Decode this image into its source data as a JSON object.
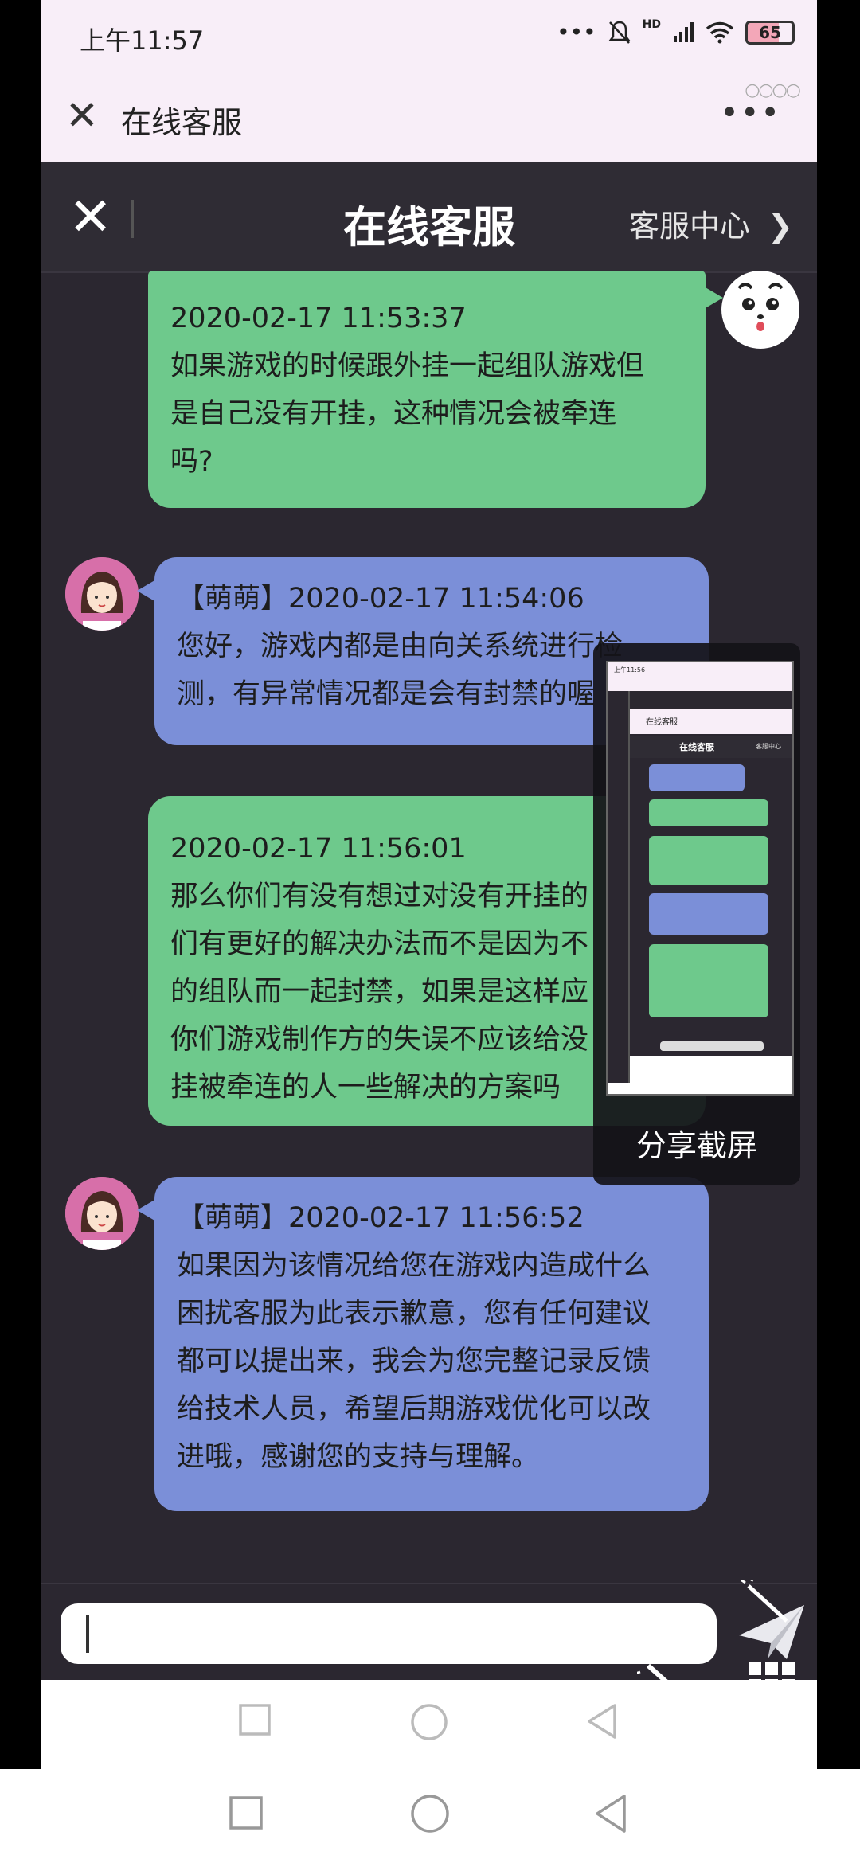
{
  "status_bar": {
    "time": "上午11:57",
    "icons": [
      "more-dots-icon",
      "mute-bell-icon",
      "signal-icon",
      "wifi-icon"
    ],
    "network_label": "HD",
    "battery": "65"
  },
  "app_bar": {
    "title": "在线客服",
    "more": "•••"
  },
  "web_header": {
    "title": "在线客服",
    "center_link": "客服中心"
  },
  "messages": [
    {
      "sender": "user",
      "lines": [
        "2020-02-17 11:53:37",
        "如果游戏的时候跟外挂一起组队游戏但",
        "是自己没有开挂，这种情况会被牵连",
        "吗?"
      ]
    },
    {
      "sender": "agent",
      "lines": [
        "【萌萌】2020-02-17 11:54:06",
        "您好，游戏内都是由向关系统进行检",
        "测，有异常情况都是会有封禁的喔"
      ]
    },
    {
      "sender": "user",
      "lines": [
        "2020-02-17 11:56:01",
        "那么你们有没有想过对没有开挂的",
        "们有更好的解决办法而不是因为不",
        "的组队而一起封禁，如果是这样应",
        "你们游戏制作方的失误不应该给没",
        "挂被牵连的人一些解决的方案吗"
      ]
    },
    {
      "sender": "agent",
      "lines": [
        "【萌萌】2020-02-17 11:56:52",
        "如果因为该情况给您在游戏内造成什么",
        "困扰客服为此表示歉意，您有任何建议",
        "都可以提出来，我会为您完整记录反馈",
        "给技术人员，希望后期游戏优化可以改",
        "进哦，感谢您的支持与理解。"
      ]
    }
  ],
  "input": {
    "value": "",
    "placeholder": ""
  },
  "preview": {
    "label": "分享截屏",
    "thumb_header": "在线客服",
    "thumb_center": "客服中心",
    "thumb_time": "上午11:56"
  },
  "colors": {
    "user_bubble": "#6ec98c",
    "agent_bubble": "#7b8fd8",
    "chat_bg": "#2b2730",
    "app_bar_bg": "#f8eef8"
  }
}
